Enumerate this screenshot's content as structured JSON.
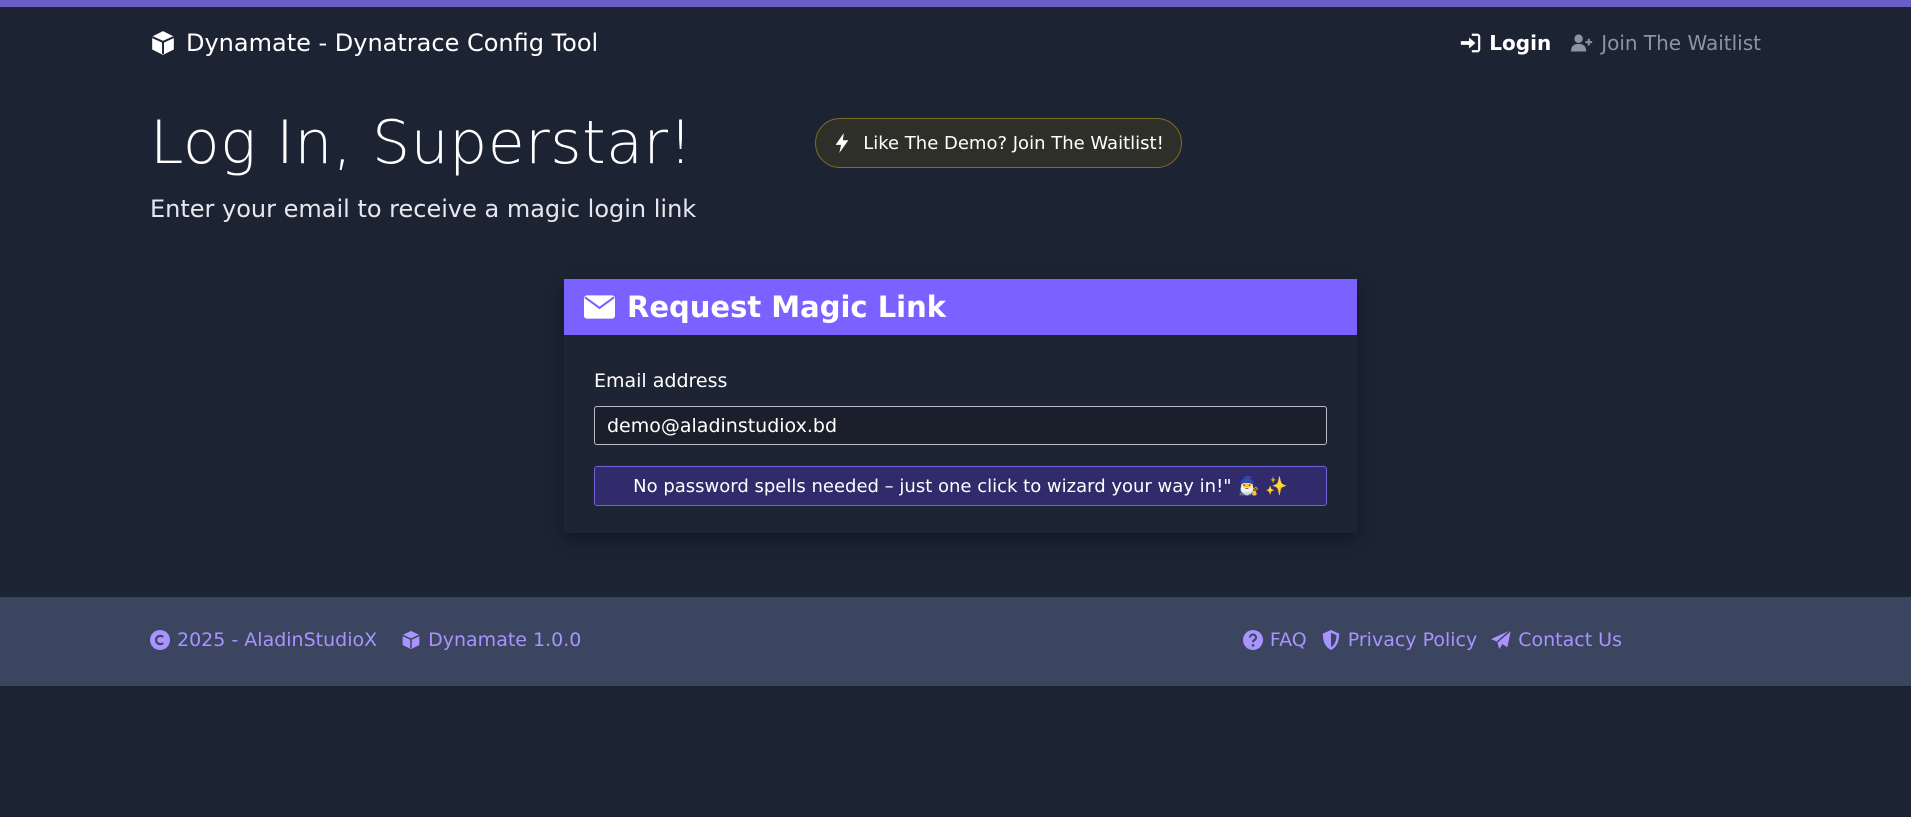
{
  "navbar": {
    "brand_title": "Dynamate - Dynatrace Config Tool",
    "brand_icon": "cube-icon",
    "login_label": "Login",
    "login_icon": "sign-in-icon",
    "waitlist_label": "Join The Waitlist",
    "waitlist_icon": "user-plus-icon"
  },
  "hero": {
    "title": "Log In, Superstar!",
    "subtitle": "Enter your email to receive a magic login link",
    "demo_button_label": "Like The Demo? Join The Waitlist!",
    "demo_button_icon": "bolt-icon"
  },
  "card": {
    "header_title": "Request Magic Link",
    "header_icon": "envelope-icon",
    "email_label": "Email address",
    "email_value": "demo@aladinstudiox.bd",
    "submit_label": "No password spells needed – just one click to wizard your way in!\" 🧙‍♂️ ✨"
  },
  "footer": {
    "copyright": "2025 - AladinStudioX",
    "copyright_icon": "copyright-icon",
    "version": "Dynamate 1.0.0",
    "version_icon": "cube-icon",
    "faq": "FAQ",
    "faq_icon": "question-circle-icon",
    "privacy": "Privacy Policy",
    "privacy_icon": "shield-icon",
    "contact": "Contact Us",
    "contact_icon": "paper-plane-icon"
  },
  "colors": {
    "background": "#1c2333",
    "accent": "#7b61ff",
    "footer_bg": "#3b4560",
    "footer_link": "#a893ff",
    "top_stripe": "#6a5fc8"
  }
}
